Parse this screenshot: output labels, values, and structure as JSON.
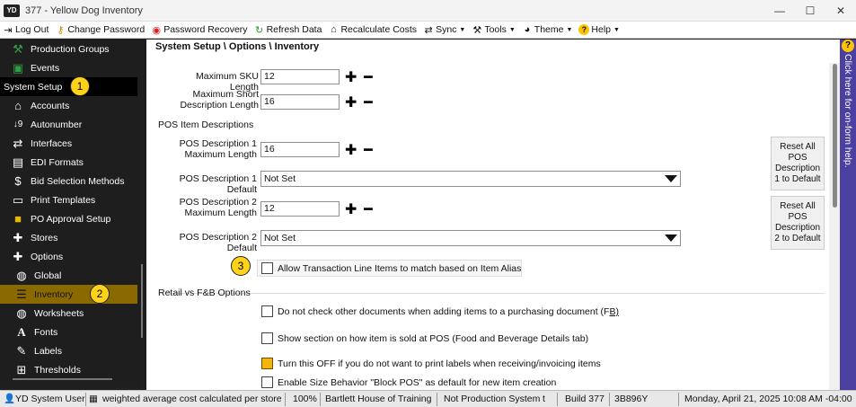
{
  "window": {
    "logo": "YD",
    "title": "377 - Yellow Dog Inventory",
    "minimize": "—",
    "maximize": "☐",
    "close": "✕"
  },
  "menubar": {
    "logout": "Log Out",
    "change_password": "Change Password",
    "password_recovery": "Password Recovery",
    "refresh_data": "Refresh Data",
    "recalculate_costs": "Recalculate Costs",
    "sync": "Sync",
    "tools": "Tools",
    "theme": "Theme",
    "help": "Help"
  },
  "sidebar": {
    "items": [
      {
        "label": "Production Groups",
        "icon": "hammer-icon"
      },
      {
        "label": "Events",
        "icon": "calendar-icon"
      },
      {
        "label": "System Setup",
        "icon": ""
      },
      {
        "label": "Accounts",
        "icon": "bank-icon"
      },
      {
        "label": "Autonumber",
        "icon": "numbering-icon"
      },
      {
        "label": "Interfaces",
        "icon": "arrows-icon"
      },
      {
        "label": "EDI Formats",
        "icon": "keyboard-icon"
      },
      {
        "label": "Bid Selection Methods",
        "icon": "dollar-icon"
      },
      {
        "label": "Print Templates",
        "icon": "print-icon"
      },
      {
        "label": "PO Approval Setup",
        "icon": "po-icon"
      },
      {
        "label": "Stores",
        "icon": "plus-icon"
      },
      {
        "label": "Options",
        "icon": "plus-icon"
      },
      {
        "label": "Global",
        "icon": "globe-icon"
      },
      {
        "label": "Inventory",
        "icon": "sliders-icon"
      },
      {
        "label": "Worksheets",
        "icon": "globe-icon"
      },
      {
        "label": "Fonts",
        "icon": "font-icon"
      },
      {
        "label": "Labels",
        "icon": "label-icon"
      },
      {
        "label": "Thresholds",
        "icon": "threshold-icon"
      }
    ]
  },
  "badges": {
    "one": "1",
    "two": "2",
    "three": "3"
  },
  "main": {
    "breadcrumb": "System Setup \\ Options \\ Inventory",
    "max_sku_label": "Maximum SKU Length",
    "max_sku_value": "12",
    "max_short_desc_label_1": "Maximum Short",
    "max_short_desc_label_2": "Description Length",
    "max_short_desc_value": "16",
    "pos_group_label": "POS Item Descriptions",
    "pos1_max_label_1": "POS Description 1",
    "pos1_max_label_2": "Maximum Length",
    "pos1_max_value": "16",
    "pos1_default_label": "POS Description 1 Default",
    "pos1_default_value": "Not Set",
    "pos2_max_label_1": "POS Description 2",
    "pos2_max_label_2": "Maximum Length",
    "pos2_max_value": "12",
    "pos2_default_label": "POS Description 2 Default",
    "pos2_default_value": "Not Set",
    "reset1": [
      "Reset All",
      "POS",
      "Description",
      "1 to Default"
    ],
    "reset2": [
      "Reset All",
      "POS",
      "Description",
      "2 to Default"
    ],
    "alias_checkbox": "Allow Transaction Line Items to match based on Item Alias",
    "retail_group_label": "Retail vs F&B Options",
    "chk_no_check_docs": "Do not check other documents when adding items to a purchasing document (F",
    "chk_no_check_docs_suffix": "B)",
    "chk_show_section": "Show section on how item is sold at POS (Food and Beverage Details tab)",
    "chk_turn_off_labels": "Turn this OFF if you do not want to print labels when receiving/invoicing items",
    "chk_size_behavior": "Enable Size Behavior \"Block POS\" as default for new item creation",
    "plus": "✚",
    "minus": "━"
  },
  "help_strip": {
    "icon": "?",
    "text": "Click here for on-form help."
  },
  "statusbar": {
    "user": "YD System User",
    "cost_method": "weighted average cost calculated per store",
    "zoom": "100%",
    "company": "Bartlett House of Training",
    "system": "Not Production System",
    "suffix": "t",
    "build": "Build 377",
    "hash": "3B896Y",
    "datetime": "Monday, April 21, 2025 10:08 AM -04:00"
  }
}
